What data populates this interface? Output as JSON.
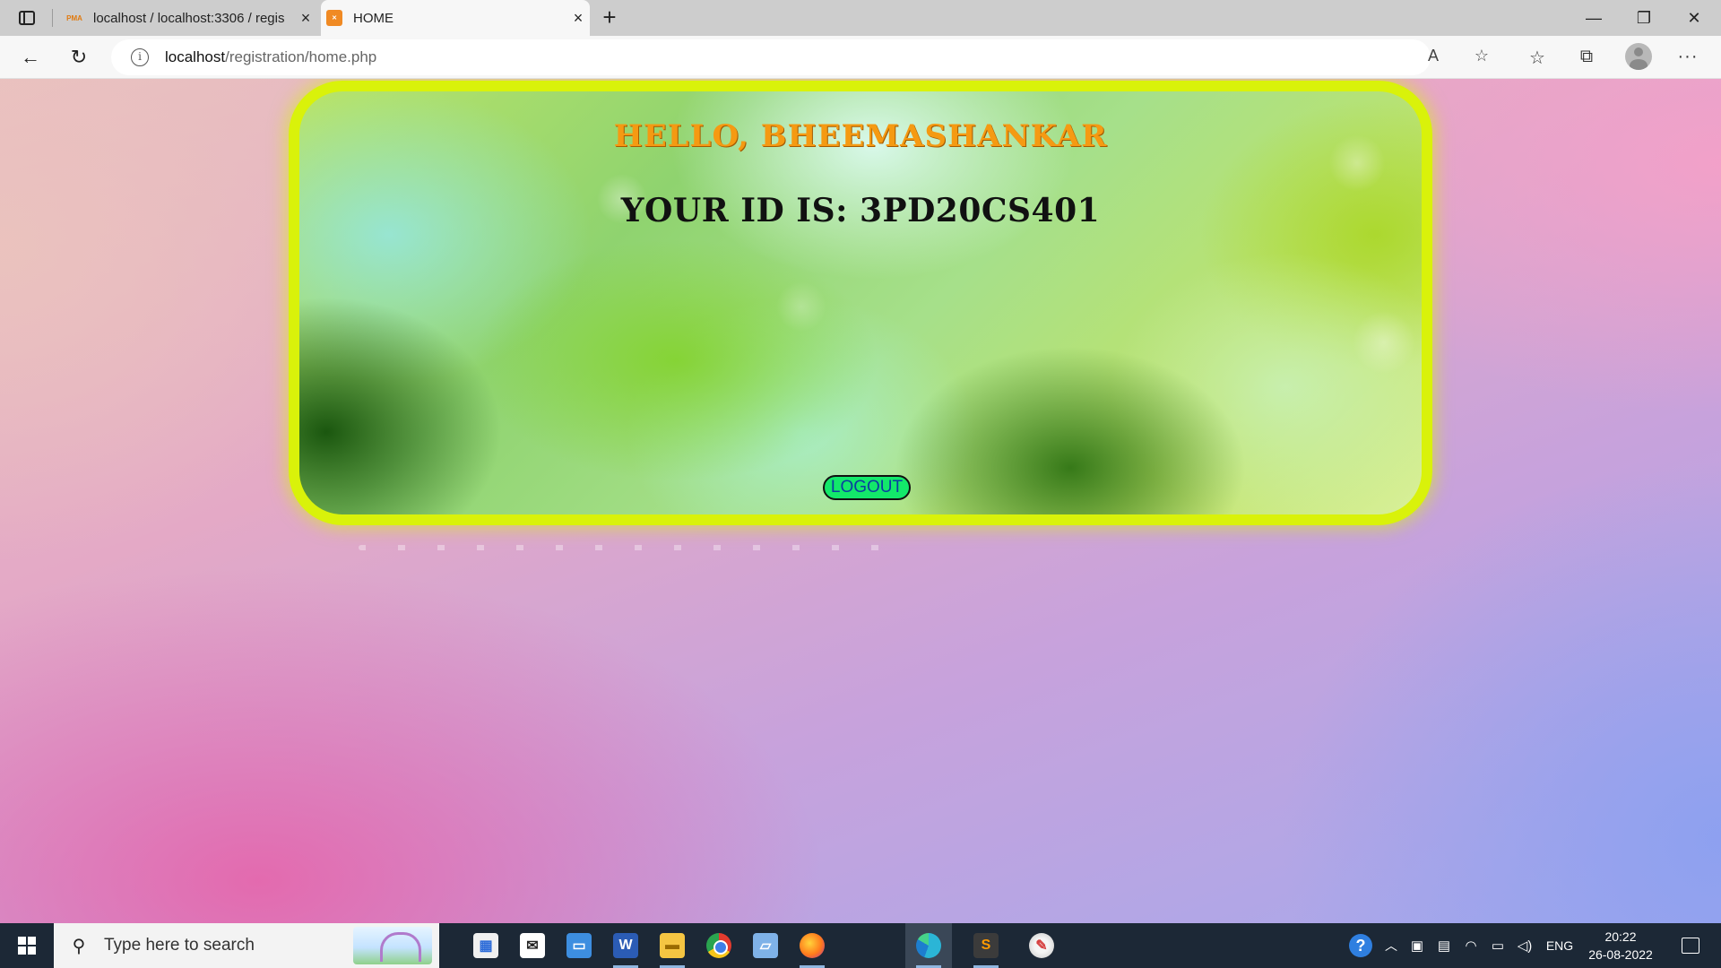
{
  "browser": {
    "tabs": [
      {
        "label": "localhost / localhost:3306 / regis",
        "favicon": "phpmyadmin-icon",
        "active": false
      },
      {
        "label": "HOME",
        "favicon": "xampp-icon",
        "active": true
      }
    ],
    "url_host": "localhost",
    "url_path": "/registration/home.php"
  },
  "page": {
    "greeting": "HELLO, BHEEMASHANKAR",
    "id_line": "YOUR ID IS: 3PD20CS401",
    "logout_label": "LOGOUT",
    "colors": {
      "card_border": "#d9f20a",
      "greeting": "#f59a12",
      "logout_bg": "#13e86a",
      "logout_text": "#0b3fa0"
    }
  },
  "taskbar": {
    "search_placeholder": "Type here to search",
    "apps": [
      "store-icon",
      "mail-icon",
      "remote-desktop-icon",
      "word-icon",
      "file-explorer-icon",
      "chrome-icon",
      "remote-app-icon",
      "firefox-icon",
      "edge-icon",
      "sublime-text-icon",
      "paint-icon"
    ],
    "language": "ENG",
    "time": "20:22",
    "date": "26-08-2022"
  }
}
